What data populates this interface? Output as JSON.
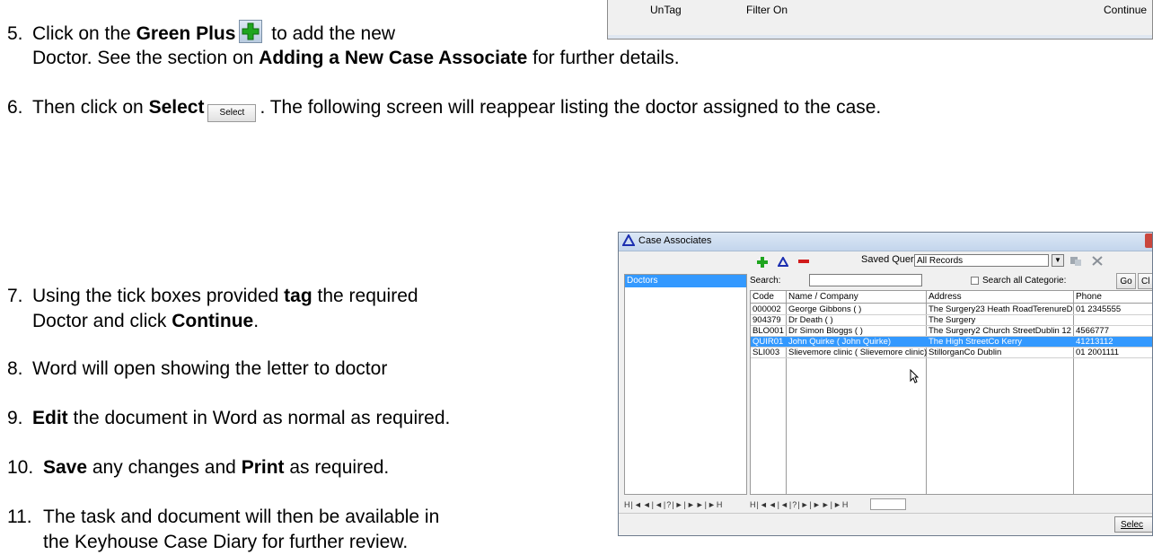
{
  "top_window": {
    "untag_label": "UnTag",
    "filter_label": "Filter On",
    "continue_label": "Continue"
  },
  "steps": [
    {
      "num": "5.",
      "line1_pre": "Click on the ",
      "line1_bold": "Green Plus",
      "line1_post": " to add the new",
      "line2_pre": "Doctor. See the section on ",
      "line2_bold": "Adding a New Case Associate",
      "line2_post": " for further details."
    },
    {
      "num": "6.",
      "pre": "Then click on ",
      "bold": "Select",
      "post": ". The following screen will reappear listing the doctor assigned to the case.",
      "button_label": "Select"
    },
    {
      "num": "7.",
      "line1_pre": "Using the tick boxes provided ",
      "line1_bold": "tag",
      "line1_post": " the required",
      "line2_pre": "Doctor and click ",
      "line2_bold": "Continue",
      "line2_post": "."
    },
    {
      "num": "8.",
      "text": "Word will open showing the letter to doctor"
    },
    {
      "num": "9.",
      "bold": "Edit",
      "post": " the document in Word as normal as required."
    },
    {
      "num": "10.",
      "bold1": "Save",
      "mid": " any changes and ",
      "bold2": "Print",
      "post": " as required."
    },
    {
      "num": "11.",
      "line1": "The task and document will then be available in",
      "line2": "the Keyhouse Case Diary for further review."
    }
  ],
  "case_window": {
    "title": "Case Associates",
    "saved_queries_label": "Saved Queries:",
    "saved_queries_value": "All Records",
    "left_selected": "Doctors",
    "search_label": "Search:",
    "search_value": "",
    "search_all_label": "Search all Categorie:",
    "go_label": "Go",
    "clear_label": "Cl",
    "select_label": "Selec",
    "nav_left": "H|◄◄|◄|?|►|►►|►H",
    "nav_right": "H|◄◄|◄|?|►|►►|►H",
    "columns": [
      "Code",
      "Name / Company",
      "Address",
      "Phone"
    ],
    "rows": [
      [
        "000002",
        "George Gibbons ( )",
        "The Surgery23 Heath RoadTerenureD",
        "01 2345555"
      ],
      [
        "904379",
        "Dr Death ( )",
        "The Surgery",
        ""
      ],
      [
        "BLO001",
        "Dr Simon Bloggs ( )",
        "The Surgery2 Church StreetDublin 12",
        "4566777"
      ],
      [
        "QUIR01",
        "John Quirke ( John Quirke)",
        "The High StreetCo Kerry",
        "41213112"
      ],
      [
        "SLI003",
        "Slievemore clinic ( Slievemore clinic)",
        "StillorganCo Dublin",
        "01 2001111"
      ]
    ],
    "selected_row_index": 3
  },
  "colors": {
    "selection": "#3399ff",
    "plus_green": "#1fa51f",
    "remove_red": "#d11c1c"
  }
}
